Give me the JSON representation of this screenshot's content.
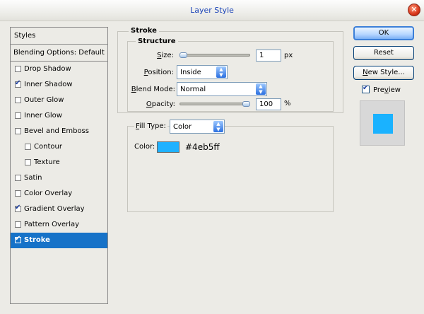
{
  "window": {
    "title": "Layer Style",
    "close_glyph": "✕"
  },
  "styles_panel": {
    "header": "Styles",
    "blending_options": "Blending Options: Default",
    "items": [
      {
        "label": "Drop Shadow",
        "checked": false,
        "indent": false,
        "selected": false
      },
      {
        "label": "Inner Shadow",
        "checked": true,
        "indent": false,
        "selected": false
      },
      {
        "label": "Outer Glow",
        "checked": false,
        "indent": false,
        "selected": false
      },
      {
        "label": "Inner Glow",
        "checked": false,
        "indent": false,
        "selected": false
      },
      {
        "label": "Bevel and Emboss",
        "checked": false,
        "indent": false,
        "selected": false
      },
      {
        "label": "Contour",
        "checked": false,
        "indent": true,
        "selected": false
      },
      {
        "label": "Texture",
        "checked": false,
        "indent": true,
        "selected": false
      },
      {
        "label": "Satin",
        "checked": false,
        "indent": false,
        "selected": false
      },
      {
        "label": "Color Overlay",
        "checked": false,
        "indent": false,
        "selected": false
      },
      {
        "label": "Gradient Overlay",
        "checked": true,
        "indent": false,
        "selected": false
      },
      {
        "label": "Pattern Overlay",
        "checked": false,
        "indent": false,
        "selected": false
      },
      {
        "label": "Stroke",
        "checked": true,
        "indent": false,
        "selected": true
      }
    ]
  },
  "stroke": {
    "title": "Stroke",
    "structure_title": "Structure",
    "size_label_u": "S",
    "size_label_rest": "ize:",
    "size_value": "1",
    "size_unit": "px",
    "size_fraction": 0.0,
    "position_label_u": "P",
    "position_label_rest": "osition:",
    "position_value": "Inside",
    "blend_mode_label_u": "B",
    "blend_mode_label_rest": "lend Mode:",
    "blend_mode_value": "Normal",
    "opacity_label_u": "O",
    "opacity_label_rest": "pacity:",
    "opacity_value": "100",
    "opacity_unit": "%",
    "opacity_fraction": 1.0,
    "fill_type_label_u": "F",
    "fill_type_label_rest": "ill Type:",
    "fill_type_value": "Color",
    "color_label": "Color:",
    "color_hex": "#4eb5ff",
    "color_swatch": "#1fb1ff"
  },
  "buttons": {
    "ok": "OK",
    "reset": "Reset",
    "new_style_u": "N",
    "new_style_rest": "ew Style...",
    "preview_label_u": "v",
    "preview_label_pre": "Pre",
    "preview_label_post": "iew",
    "preview_checked": true,
    "preview_color": "#1ab2ff"
  },
  "colors": {
    "selected_row": "#1672c8",
    "title_text": "#1c44b8"
  }
}
